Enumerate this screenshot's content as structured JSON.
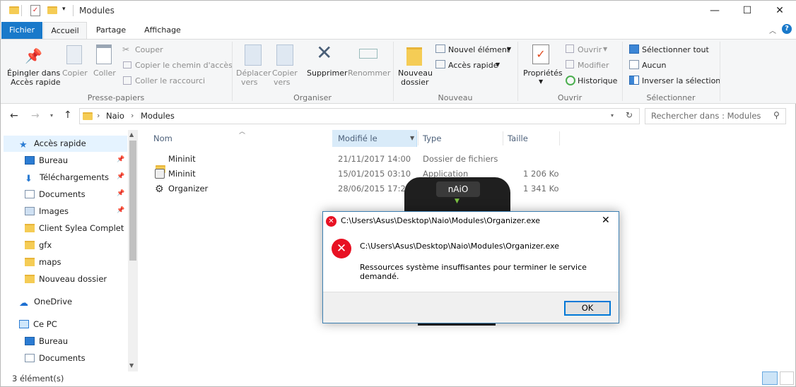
{
  "window": {
    "title": "Modules",
    "minimize_glyph": "—",
    "maximize_glyph": "☐",
    "close_glyph": "✕"
  },
  "tabs": [
    "Fichier",
    "Accueil",
    "Partage",
    "Affichage"
  ],
  "ribbon": {
    "presse_papiers": {
      "group": "Presse-papiers",
      "pin_label_1": "Épingler dans",
      "pin_label_2": "Accès rapide",
      "copier": "Copier",
      "coller": "Coller",
      "couper": "Couper",
      "copier_chemin": "Copier le chemin d'accès",
      "coller_raccourci": "Coller le raccourci"
    },
    "organiser": {
      "group": "Organiser",
      "deplacer_1": "Déplacer",
      "deplacer_2": "vers",
      "copier_1": "Copier",
      "copier_2": "vers",
      "supprimer": "Supprimer",
      "renommer": "Renommer"
    },
    "nouveau": {
      "group": "Nouveau",
      "nouveau_dossier_1": "Nouveau",
      "nouveau_dossier_2": "dossier",
      "nouvel_element": "Nouvel élément",
      "acces_rapide": "Accès rapide"
    },
    "ouvrir": {
      "group": "Ouvrir",
      "proprietes": "Propriétés",
      "ouvrir": "Ouvrir",
      "modifier": "Modifier",
      "historique": "Historique"
    },
    "selectionner": {
      "group": "Sélectionner",
      "tout": "Sélectionner tout",
      "aucun": "Aucun",
      "inverser": "Inverser la sélection"
    }
  },
  "address": {
    "crumbs": [
      "Naio",
      "Modules"
    ],
    "search_placeholder": "Rechercher dans : Modules"
  },
  "nav": {
    "items": [
      {
        "label": "Accès rapide",
        "icon": "star-icon"
      },
      {
        "label": "Bureau",
        "icon": "desktop-icon"
      },
      {
        "label": "Téléchargements",
        "icon": "download-icon"
      },
      {
        "label": "Documents",
        "icon": "document-icon"
      },
      {
        "label": "Images",
        "icon": "image-icon"
      },
      {
        "label": "Client Sylea Complet",
        "icon": "folder-icon"
      },
      {
        "label": "gfx",
        "icon": "folder-icon"
      },
      {
        "label": "maps",
        "icon": "folder-icon"
      },
      {
        "label": "Nouveau dossier",
        "icon": "folder-icon"
      },
      {
        "label": "OneDrive",
        "icon": "cloud-icon"
      },
      {
        "label": "Ce PC",
        "icon": "pc-icon"
      },
      {
        "label": "Bureau",
        "icon": "desktop-icon"
      },
      {
        "label": "Documents",
        "icon": "document-icon"
      }
    ]
  },
  "columns": [
    "Nom",
    "Modifié le",
    "Type",
    "Taille"
  ],
  "files": [
    {
      "name": "Mininit",
      "date": "21/11/2017 14:00",
      "type": "Dossier de fichiers",
      "size": ""
    },
    {
      "name": "Mininit",
      "date": "15/01/2015 03:10",
      "type": "Application",
      "size": "1 206 Ko"
    },
    {
      "name": "Organizer",
      "date": "28/06/2015 17:25",
      "type": "",
      "size": "1 341 Ko"
    }
  ],
  "status": "3 élément(s)",
  "splash": {
    "logo": "nAiO"
  },
  "dialog": {
    "title": "C:\\Users\\Asus\\Desktop\\Naio\\Modules\\Organizer.exe",
    "path": "C:\\Users\\Asus\\Desktop\\Naio\\Modules\\Organizer.exe",
    "message": "Ressources système insuffisantes pour terminer le service demandé.",
    "ok": "OK",
    "close_glyph": "✕"
  },
  "colors": {
    "accent": "#1979ca",
    "error": "#e81123",
    "folder": "#f5cc55"
  }
}
